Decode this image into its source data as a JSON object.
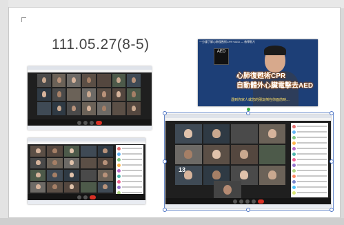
{
  "slide": {
    "title": "111.05.27(8-5)"
  },
  "video": {
    "header_text": "一分鐘了解心肺復甦術CPR+AED — 教學影片",
    "aed_label": "AED",
    "caption_line1": "心肺復甦術CPR",
    "caption_line2": "自動體外心臟電擊去AED",
    "subtitle": "遇到你家人或您的朋友倒在你面前時…"
  },
  "big_shot": {
    "tile_badge": "13"
  },
  "colors": {
    "slide_bg": "#ffffff",
    "meeting_bg": "#1f1f1f",
    "end_call_red": "#d93025",
    "video_blue": "#1d3f77"
  }
}
